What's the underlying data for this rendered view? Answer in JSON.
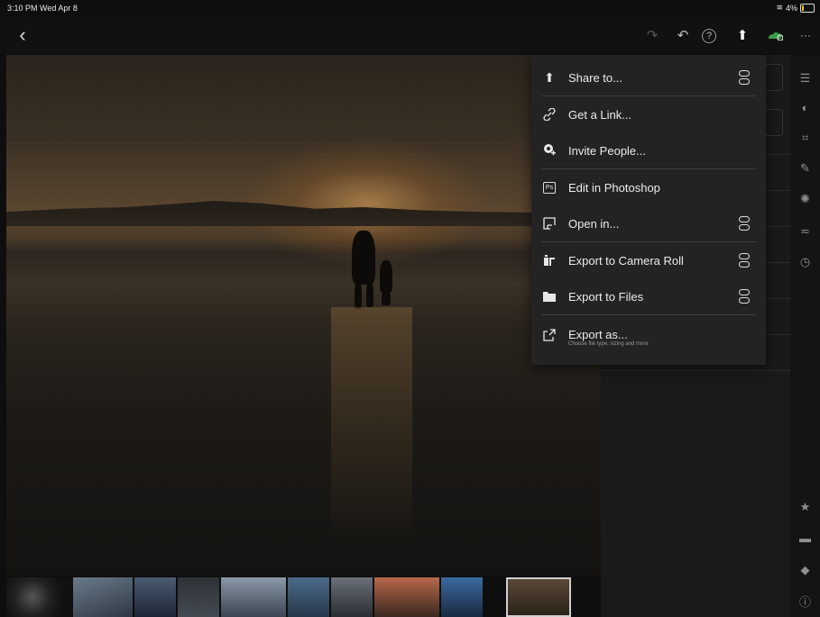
{
  "status_bar": {
    "time": "3:10 PM  Wed Apr 8",
    "battery_percent": "4%"
  },
  "toolbar": {
    "back": "‹",
    "redo": "↷",
    "undo": "↶",
    "help": "?",
    "share": "⬆",
    "more": "···"
  },
  "share_menu": {
    "items": [
      {
        "label": "Share to...",
        "icon": "share-icon",
        "glyph": "⬆",
        "toggle": true
      },
      {
        "label": "Get a Link...",
        "icon": "link-icon",
        "glyph": "🔗",
        "toggle": false
      },
      {
        "label": "Invite People...",
        "icon": "invite-people-icon",
        "glyph": "⊕",
        "toggle": false
      },
      {
        "label": "Edit in Photoshop",
        "icon": "photoshop-icon",
        "glyph": "Ps",
        "toggle": false
      },
      {
        "label": "Open in...",
        "icon": "open-in-icon",
        "glyph": "⎘",
        "toggle": true
      },
      {
        "label": "Export to Camera Roll",
        "icon": "camera-roll-icon",
        "glyph": "▮",
        "toggle": true
      },
      {
        "label": "Export to Files",
        "icon": "folder-icon",
        "glyph": "▬",
        "toggle": true
      },
      {
        "label": "Export as...",
        "sublabel": "Choose file type, sizing and more",
        "icon": "export-as-icon",
        "glyph": "⤴",
        "toggle": false
      }
    ]
  },
  "side_rail": {
    "icons": [
      "sliders-icon",
      "healing-icon",
      "crop-icon",
      "brush-icon",
      "effects-icon",
      "presets-icon",
      "history-icon",
      "star-icon",
      "comment-icon",
      "tag-icon",
      "info-icon"
    ]
  },
  "filmstrip": {
    "thumbnail_count": 12,
    "undo_icon": "↶"
  }
}
